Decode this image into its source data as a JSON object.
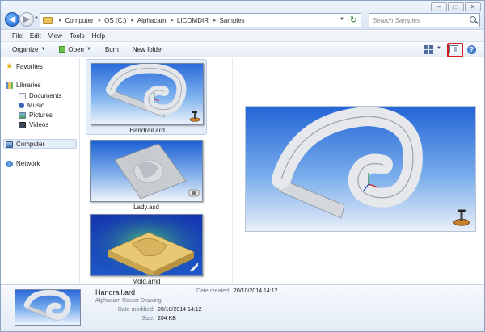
{
  "window": {
    "controls": {
      "minimize": "–",
      "maximize": "□",
      "close": "✕"
    }
  },
  "address": {
    "crumbs": [
      "Computer",
      "OS (C:)",
      "Alphacam",
      "LICOMDIR",
      "Samples"
    ]
  },
  "search": {
    "placeholder": "Search Samples"
  },
  "menu": {
    "items": [
      "File",
      "Edit",
      "View",
      "Tools",
      "Help"
    ]
  },
  "toolbar": {
    "organize": "Organize",
    "open": "Open",
    "burn": "Burn",
    "new_folder": "New folder",
    "help": "?"
  },
  "sidebar": {
    "items": [
      {
        "label": "Favorites"
      },
      {
        "label": "Libraries"
      },
      {
        "label": "Documents"
      },
      {
        "label": "Music"
      },
      {
        "label": "Pictures"
      },
      {
        "label": "Videos"
      },
      {
        "label": "Computer"
      },
      {
        "label": "Network"
      }
    ]
  },
  "files": [
    {
      "name": "Handrail.ard",
      "selected": true
    },
    {
      "name": "Lady.asd",
      "selected": false
    },
    {
      "name": "Mold.amd",
      "selected": false
    }
  ],
  "details": {
    "name": "Handrail.ard",
    "type": "Alphacam Router Drawing",
    "date_created_label": "Date created:",
    "date_created": "20/10/2014 14:12",
    "date_modified_label": "Date modified:",
    "date_modified": "20/10/2014 14:12",
    "size_label": "Size:",
    "size": "204 KB"
  },
  "colors": {
    "highlight": "#d51d1d",
    "selection": "#e6eef9",
    "thumb_bg": "#2c6cda"
  }
}
